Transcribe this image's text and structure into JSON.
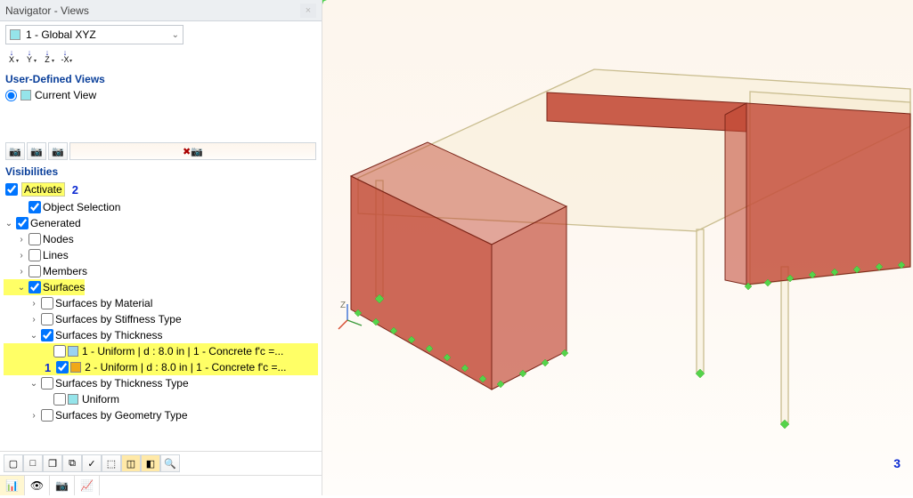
{
  "window": {
    "title": "Navigator - Views",
    "close_icon": "×"
  },
  "viewSelect": {
    "label": "1 - Global XYZ"
  },
  "axisButtons": [
    "X",
    "Y",
    "Z",
    "-X"
  ],
  "userDefined": {
    "title": "User-Defined Views",
    "current": "Current View"
  },
  "visibilities": {
    "title": "Visibilities",
    "activate": "Activate"
  },
  "tree": {
    "objectSelection": "Object Selection",
    "generated": "Generated",
    "nodes": "Nodes",
    "lines": "Lines",
    "members": "Members",
    "surfaces": "Surfaces",
    "byMaterial": "Surfaces by Material",
    "byStiffness": "Surfaces by Stiffness Type",
    "byThickness": "Surfaces by Thickness",
    "thick1": "1 - Uniform | d : 8.0 in | 1 - Concrete f'c =...",
    "thick2": "2 - Uniform | d : 8.0 in | 1 - Concrete f'c =...",
    "byThicknessType": "Surfaces by Thickness Type",
    "uniform": "Uniform",
    "byGeometry": "Surfaces by Geometry Type"
  },
  "annot": {
    "one": "1",
    "two": "2",
    "three": "3"
  },
  "colors": {
    "thick1": "#9ad2f2",
    "thick2": "#f0a918"
  },
  "axis3d": {
    "z": "Z"
  }
}
